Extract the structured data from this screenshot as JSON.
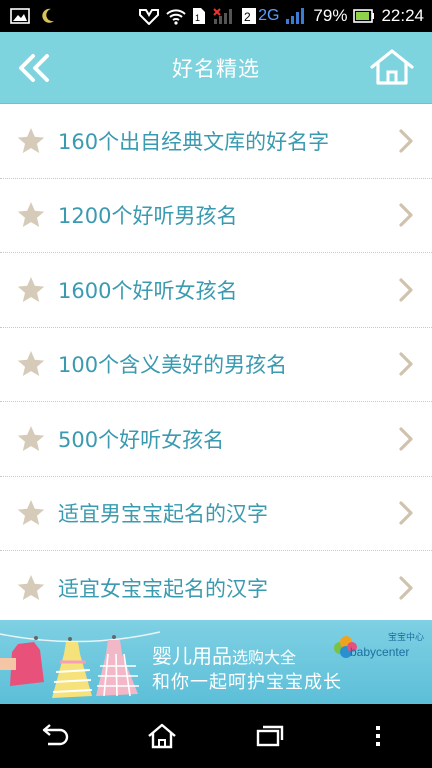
{
  "status_bar": {
    "battery_percent": "79%",
    "time": "22:24",
    "network": "2G",
    "icons": [
      "image-icon",
      "moon-icon",
      "notification-icon",
      "wifi-icon",
      "sim-icon",
      "signal-icon",
      "battery-icon"
    ]
  },
  "header": {
    "title": "好名精选",
    "back_icon": "double-chevron-left-icon",
    "home_icon": "home-icon"
  },
  "list": {
    "items": [
      {
        "label": "160个出自经典文库的好名字"
      },
      {
        "label": "1200个好听男孩名"
      },
      {
        "label": "1600个好听女孩名"
      },
      {
        "label": "100个含义美好的男孩名"
      },
      {
        "label": "500个好听女孩名"
      },
      {
        "label": "适宜男宝宝起名的汉字"
      },
      {
        "label": "适宜女宝宝起名的汉字"
      }
    ],
    "star_color": "#d6cbb8",
    "text_color": "#3a9ab0"
  },
  "banner": {
    "line1_main": "婴儿用品",
    "line1_sub": "选购大全",
    "line2": "和你一起呵护宝宝成长",
    "brand_small": "宝宝中心",
    "brand_name": "babycenter"
  },
  "nav_bar": {
    "buttons": [
      "back-icon",
      "home-icon",
      "recent-apps-icon",
      "menu-icon"
    ]
  },
  "colors": {
    "header_bg": "#7dd3de",
    "banner_bg": "#5cbfd8"
  }
}
